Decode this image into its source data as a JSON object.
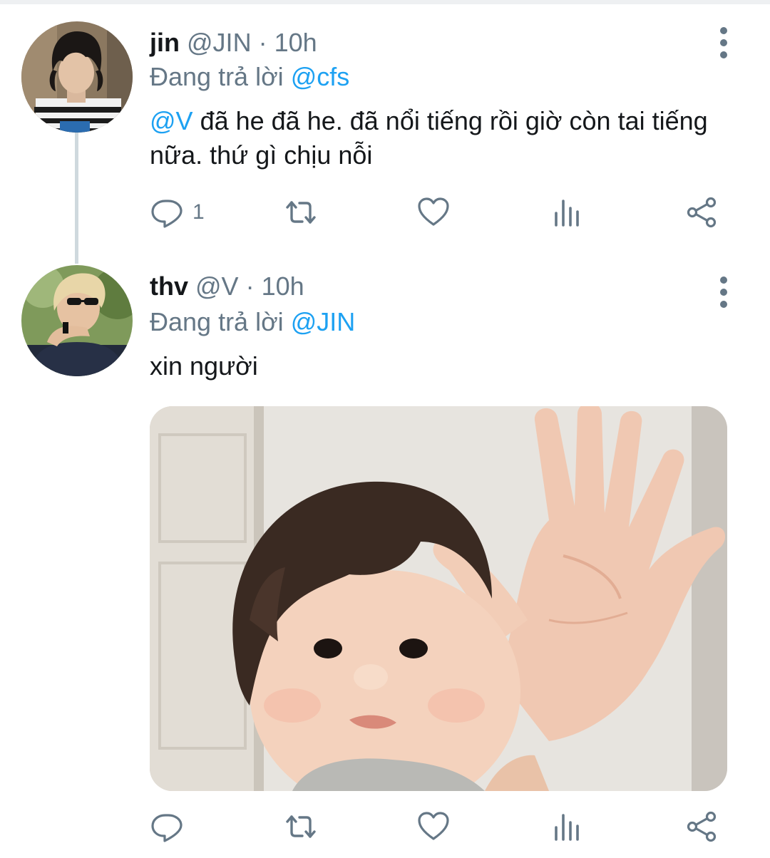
{
  "tweets": [
    {
      "name": "jin",
      "handle": "@JIN",
      "separator": "·",
      "time": "10h",
      "reply_prefix": "Đang trả lời",
      "reply_to": "@cfs",
      "mention": "@V",
      "text": " đã he đã he. đã nổi tiếng rồi giờ còn tai tiếng nữa. thứ gì chịu nỗi",
      "reply_count": "1"
    },
    {
      "name": "thv",
      "handle": "@V",
      "separator": "·",
      "time": "10h",
      "reply_prefix": "Đang trả lời",
      "reply_to": "@JIN",
      "text": "xin người",
      "reply_count": ""
    }
  ],
  "icons": {
    "reply": "reply-icon",
    "retweet": "retweet-icon",
    "like": "heart-icon",
    "analytics": "analytics-icon",
    "share": "share-icon",
    "more": "more-vertical-icon"
  },
  "colors": {
    "link": "#1da1f2",
    "secondary_text": "#657786",
    "thread_line": "#cfd9de"
  }
}
